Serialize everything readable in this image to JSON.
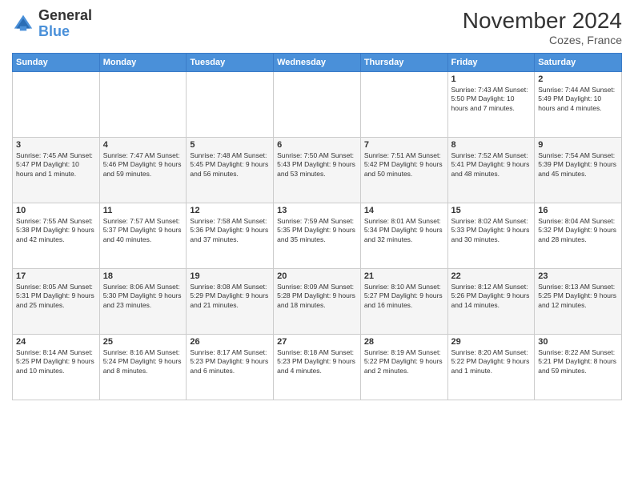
{
  "logo": {
    "general": "General",
    "blue": "Blue"
  },
  "title": "November 2024",
  "location": "Cozes, France",
  "days_header": [
    "Sunday",
    "Monday",
    "Tuesday",
    "Wednesday",
    "Thursday",
    "Friday",
    "Saturday"
  ],
  "weeks": [
    [
      {
        "day": "",
        "info": ""
      },
      {
        "day": "",
        "info": ""
      },
      {
        "day": "",
        "info": ""
      },
      {
        "day": "",
        "info": ""
      },
      {
        "day": "",
        "info": ""
      },
      {
        "day": "1",
        "info": "Sunrise: 7:43 AM\nSunset: 5:50 PM\nDaylight: 10 hours\nand 7 minutes."
      },
      {
        "day": "2",
        "info": "Sunrise: 7:44 AM\nSunset: 5:49 PM\nDaylight: 10 hours\nand 4 minutes."
      }
    ],
    [
      {
        "day": "3",
        "info": "Sunrise: 7:45 AM\nSunset: 5:47 PM\nDaylight: 10 hours\nand 1 minute."
      },
      {
        "day": "4",
        "info": "Sunrise: 7:47 AM\nSunset: 5:46 PM\nDaylight: 9 hours\nand 59 minutes."
      },
      {
        "day": "5",
        "info": "Sunrise: 7:48 AM\nSunset: 5:45 PM\nDaylight: 9 hours\nand 56 minutes."
      },
      {
        "day": "6",
        "info": "Sunrise: 7:50 AM\nSunset: 5:43 PM\nDaylight: 9 hours\nand 53 minutes."
      },
      {
        "day": "7",
        "info": "Sunrise: 7:51 AM\nSunset: 5:42 PM\nDaylight: 9 hours\nand 50 minutes."
      },
      {
        "day": "8",
        "info": "Sunrise: 7:52 AM\nSunset: 5:41 PM\nDaylight: 9 hours\nand 48 minutes."
      },
      {
        "day": "9",
        "info": "Sunrise: 7:54 AM\nSunset: 5:39 PM\nDaylight: 9 hours\nand 45 minutes."
      }
    ],
    [
      {
        "day": "10",
        "info": "Sunrise: 7:55 AM\nSunset: 5:38 PM\nDaylight: 9 hours\nand 42 minutes."
      },
      {
        "day": "11",
        "info": "Sunrise: 7:57 AM\nSunset: 5:37 PM\nDaylight: 9 hours\nand 40 minutes."
      },
      {
        "day": "12",
        "info": "Sunrise: 7:58 AM\nSunset: 5:36 PM\nDaylight: 9 hours\nand 37 minutes."
      },
      {
        "day": "13",
        "info": "Sunrise: 7:59 AM\nSunset: 5:35 PM\nDaylight: 9 hours\nand 35 minutes."
      },
      {
        "day": "14",
        "info": "Sunrise: 8:01 AM\nSunset: 5:34 PM\nDaylight: 9 hours\nand 32 minutes."
      },
      {
        "day": "15",
        "info": "Sunrise: 8:02 AM\nSunset: 5:33 PM\nDaylight: 9 hours\nand 30 minutes."
      },
      {
        "day": "16",
        "info": "Sunrise: 8:04 AM\nSunset: 5:32 PM\nDaylight: 9 hours\nand 28 minutes."
      }
    ],
    [
      {
        "day": "17",
        "info": "Sunrise: 8:05 AM\nSunset: 5:31 PM\nDaylight: 9 hours\nand 25 minutes."
      },
      {
        "day": "18",
        "info": "Sunrise: 8:06 AM\nSunset: 5:30 PM\nDaylight: 9 hours\nand 23 minutes."
      },
      {
        "day": "19",
        "info": "Sunrise: 8:08 AM\nSunset: 5:29 PM\nDaylight: 9 hours\nand 21 minutes."
      },
      {
        "day": "20",
        "info": "Sunrise: 8:09 AM\nSunset: 5:28 PM\nDaylight: 9 hours\nand 18 minutes."
      },
      {
        "day": "21",
        "info": "Sunrise: 8:10 AM\nSunset: 5:27 PM\nDaylight: 9 hours\nand 16 minutes."
      },
      {
        "day": "22",
        "info": "Sunrise: 8:12 AM\nSunset: 5:26 PM\nDaylight: 9 hours\nand 14 minutes."
      },
      {
        "day": "23",
        "info": "Sunrise: 8:13 AM\nSunset: 5:25 PM\nDaylight: 9 hours\nand 12 minutes."
      }
    ],
    [
      {
        "day": "24",
        "info": "Sunrise: 8:14 AM\nSunset: 5:25 PM\nDaylight: 9 hours\nand 10 minutes."
      },
      {
        "day": "25",
        "info": "Sunrise: 8:16 AM\nSunset: 5:24 PM\nDaylight: 9 hours\nand 8 minutes."
      },
      {
        "day": "26",
        "info": "Sunrise: 8:17 AM\nSunset: 5:23 PM\nDaylight: 9 hours\nand 6 minutes."
      },
      {
        "day": "27",
        "info": "Sunrise: 8:18 AM\nSunset: 5:23 PM\nDaylight: 9 hours\nand 4 minutes."
      },
      {
        "day": "28",
        "info": "Sunrise: 8:19 AM\nSunset: 5:22 PM\nDaylight: 9 hours\nand 2 minutes."
      },
      {
        "day": "29",
        "info": "Sunrise: 8:20 AM\nSunset: 5:22 PM\nDaylight: 9 hours\nand 1 minute."
      },
      {
        "day": "30",
        "info": "Sunrise: 8:22 AM\nSunset: 5:21 PM\nDaylight: 8 hours\nand 59 minutes."
      }
    ]
  ]
}
